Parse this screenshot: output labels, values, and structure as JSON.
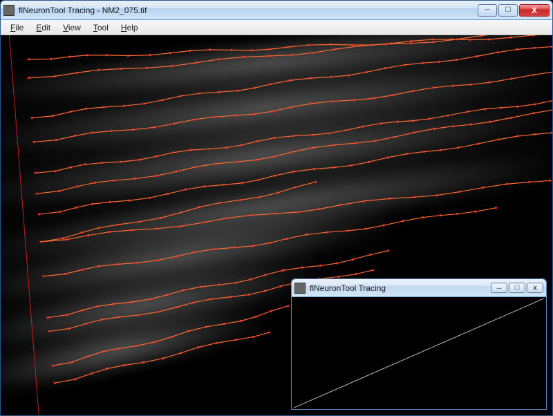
{
  "mainWindow": {
    "title": "flNeuronTool Tracing - NM2_075.tif",
    "controls": {
      "min": "─",
      "max": "☐",
      "close": "X"
    }
  },
  "menu": {
    "items": [
      {
        "key": "F",
        "rest": "ile"
      },
      {
        "key": "E",
        "rest": "dit"
      },
      {
        "key": "V",
        "rest": "iew"
      },
      {
        "key": "T",
        "rest": "ool"
      },
      {
        "key": "H",
        "rest": "elp"
      }
    ]
  },
  "subWindow": {
    "title": "flNeuronTool Tracing",
    "controls": {
      "min": "─",
      "max": "☐",
      "close": "X"
    }
  },
  "colors": {
    "traceLine": "#ff6a30",
    "traceNode": "#ff2a2a",
    "axis": "#c02020"
  }
}
